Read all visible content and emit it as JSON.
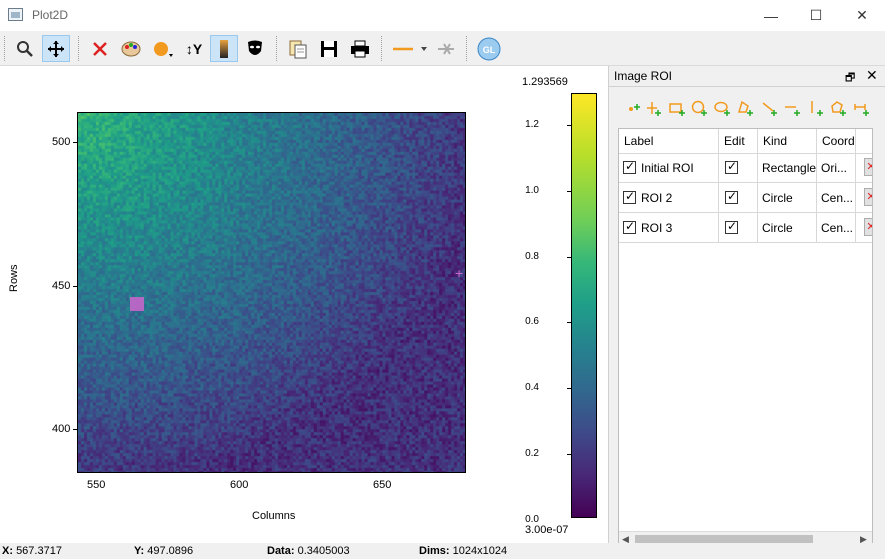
{
  "window": {
    "title": "Plot2D",
    "minimize": "—",
    "maximize": "☐",
    "close": "✕"
  },
  "toolbar": {
    "items": [
      {
        "name": "zoom-icon",
        "glyph": "🔍"
      },
      {
        "name": "pan-icon",
        "glyph": "✥"
      },
      {
        "name": "clear-icon",
        "glyph": "✕"
      },
      {
        "name": "colormap-icon",
        "glyph": "🎨"
      },
      {
        "name": "marker-icon",
        "glyph": "●"
      },
      {
        "name": "y-axis-icon",
        "glyph": "↕Y"
      },
      {
        "name": "colorbar-icon",
        "glyph": "▮"
      },
      {
        "name": "mask-icon",
        "glyph": "☻"
      },
      {
        "name": "copy-icon",
        "glyph": "📋"
      },
      {
        "name": "save-icon",
        "glyph": "💾"
      },
      {
        "name": "print-icon",
        "glyph": "🖶"
      },
      {
        "name": "profile-line-icon",
        "glyph": "—"
      },
      {
        "name": "profile-clear-icon",
        "glyph": "✕"
      },
      {
        "name": "opengl-icon",
        "glyph": "GL"
      }
    ]
  },
  "plot": {
    "ylabel": "Rows",
    "xlabel": "Columns",
    "yticks": [
      "500",
      "450",
      "400"
    ],
    "xticks": [
      "550",
      "600",
      "650"
    ]
  },
  "colorbar": {
    "max": "1.293569",
    "min": "3.00e-07",
    "ticks": [
      "1.2",
      "1.0",
      "0.8",
      "0.6",
      "0.4",
      "0.2",
      "0.0"
    ]
  },
  "dock": {
    "title": "Image ROI",
    "float_glyph": "🗗",
    "close_glyph": "✕",
    "roi_tools": [
      "point-roi-icon",
      "cross-roi-icon",
      "rectangle-roi-icon",
      "circle-roi-icon",
      "ellipse-roi-icon",
      "polygon-roi-icon",
      "line-roi-icon",
      "hline-roi-icon",
      "vline-roi-icon",
      "freehand-roi-icon",
      "hrange-roi-icon"
    ],
    "table": {
      "headers": [
        "Label",
        "Edit",
        "Kind",
        "Coord"
      ],
      "rows": [
        {
          "label": "Initial ROI",
          "kind": "Rectangle",
          "coord": "Ori..."
        },
        {
          "label": "ROI 2",
          "kind": "Circle",
          "coord": "Cen..."
        },
        {
          "label": "ROI 3",
          "kind": "Circle",
          "coord": "Cen..."
        }
      ]
    }
  },
  "status": {
    "x_label": "X:",
    "x_value": "567.3717",
    "y_label": "Y:",
    "y_value": "497.0896",
    "data_label": "Data:",
    "data_value": "0.3405003",
    "dims_label": "Dims:",
    "dims_value": "1024x1024"
  },
  "colors": {
    "accent_orange": "#f29a1f",
    "roi_marker": "#cc66cc",
    "active_tool": "#cce4f7"
  }
}
